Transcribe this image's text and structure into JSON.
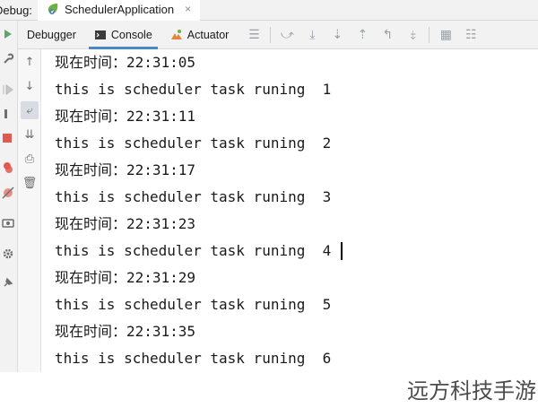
{
  "debug_bar": {
    "label": "Debug:",
    "app_tab": {
      "title": "SchedulerApplication",
      "close": "×"
    }
  },
  "tool_bar": {
    "tabs": [
      {
        "label": "Debugger",
        "icon": "debugger-icon",
        "active": false
      },
      {
        "label": "Console",
        "icon": "console-icon",
        "active": true
      },
      {
        "label": "Actuator",
        "icon": "actuator-icon",
        "active": false
      }
    ],
    "icons": [
      "menu-icon",
      "show-execution-point-icon",
      "step-over-icon",
      "step-into-icon",
      "step-out-icon",
      "run-to-cursor-icon",
      "evaluate-expression-icon",
      "table-icon",
      "settings-icon"
    ]
  },
  "console": {
    "lines": [
      "现在时间：22:31:05",
      "this is scheduler task runing  1",
      "现在时间：22:31:11",
      "this is scheduler task runing  2",
      "现在时间：22:31:17",
      "this is scheduler task runing  3",
      "现在时间：22:31:23",
      "this is scheduler task runing  4",
      "现在时间：22:31:29",
      "this is scheduler task runing  5",
      "现在时间：22:31:35",
      "this is scheduler task runing  6"
    ]
  },
  "watermark": "远方科技手游",
  "colors": {
    "accent": "#4a86c8",
    "spring": "#6db33f",
    "stop": "#e05a4f"
  }
}
